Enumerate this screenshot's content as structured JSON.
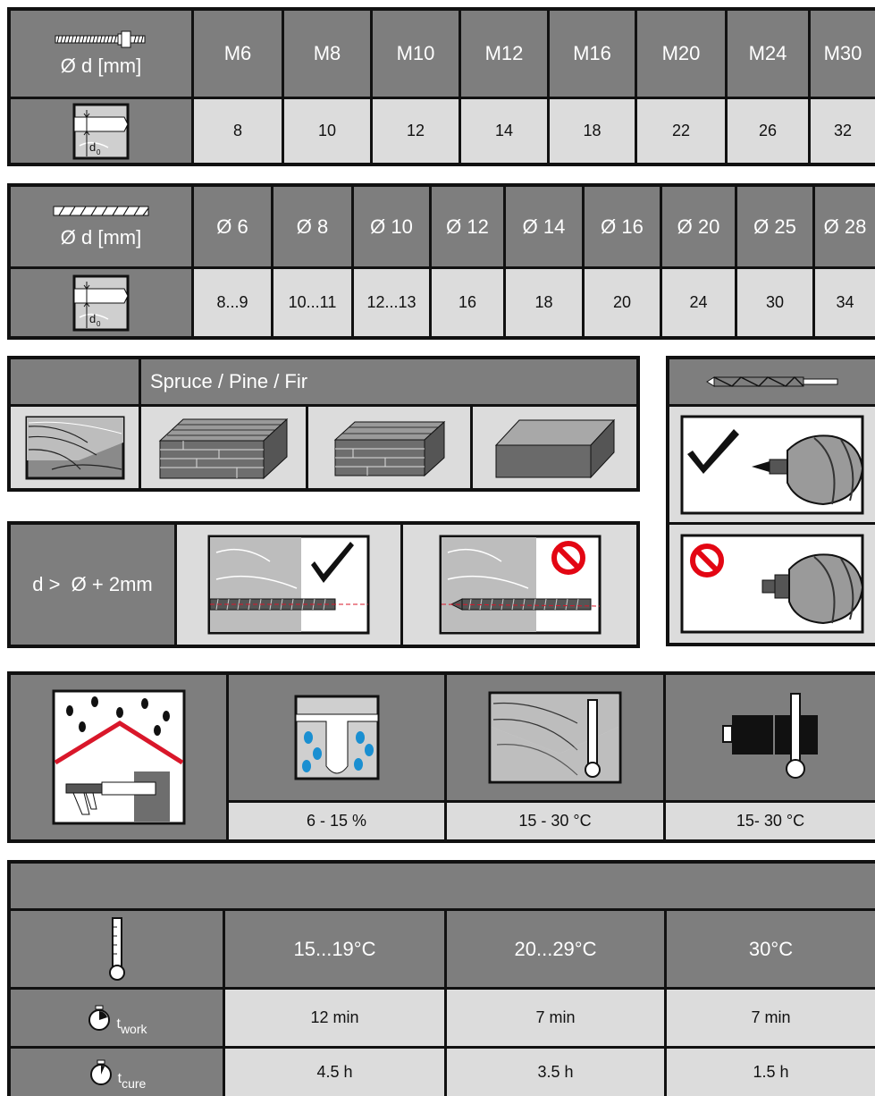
{
  "threaded_rod_table": {
    "header_label": "Ø d [mm]",
    "sizes": [
      "M6",
      "M8",
      "M10",
      "M12",
      "M16",
      "M20",
      "M24",
      "M30"
    ],
    "hole_diameters": [
      "8",
      "10",
      "12",
      "14",
      "18",
      "22",
      "26",
      "32"
    ],
    "d0_label": "d",
    "d0_sub": "0"
  },
  "rebar_table": {
    "header_label": "Ø d [mm]",
    "sizes": [
      "Ø 6",
      "Ø 8",
      "Ø 10",
      "Ø 12",
      "Ø 14",
      "Ø 16",
      "Ø 20",
      "Ø 25",
      "Ø 28"
    ],
    "hole_diameters": [
      "8...9",
      "10...11",
      "12...13",
      "16",
      "18",
      "20",
      "24",
      "30",
      "34"
    ],
    "d0_label": "d",
    "d0_sub": "0"
  },
  "wood_species": {
    "title": "Spruce / Pine / Fir",
    "icons": [
      "solid-wood-icon",
      "glulam-icon",
      "cross-laminated-timber-icon",
      "engineered-panel-icon"
    ]
  },
  "hole_clearance": {
    "condition": "d >  Ø + 2mm",
    "ok_icon": "checkmark-icon",
    "not_ok_icon": "prohibited-icon"
  },
  "drill_bit": {
    "ok_icon": "auger-bit-ok-icon",
    "not_ok_icon": "auger-bit-not-ok-icon"
  },
  "conditions": {
    "moisture": "6 - 15 %",
    "base_temp": "15 - 30 °C",
    "cartridge_temp": "15- 30 °C"
  },
  "cure_table": {
    "temps": [
      "15...19°C",
      "20...29°C",
      "30°C"
    ],
    "work_label": "t",
    "work_sub": "work",
    "cure_label": "t",
    "cure_sub": "cure",
    "work_times": [
      "12 min",
      "7 min",
      "7 min"
    ],
    "cure_times": [
      "4.5 h",
      "3.5 h",
      "1.5 h"
    ]
  },
  "colors": {
    "header_bg": "#7e7e7e",
    "value_bg": "#dcdcdc",
    "border": "#111111",
    "roof_red": "#d9172a",
    "drop_blue": "#1a8fd1",
    "prohibit_red": "#e30613"
  }
}
